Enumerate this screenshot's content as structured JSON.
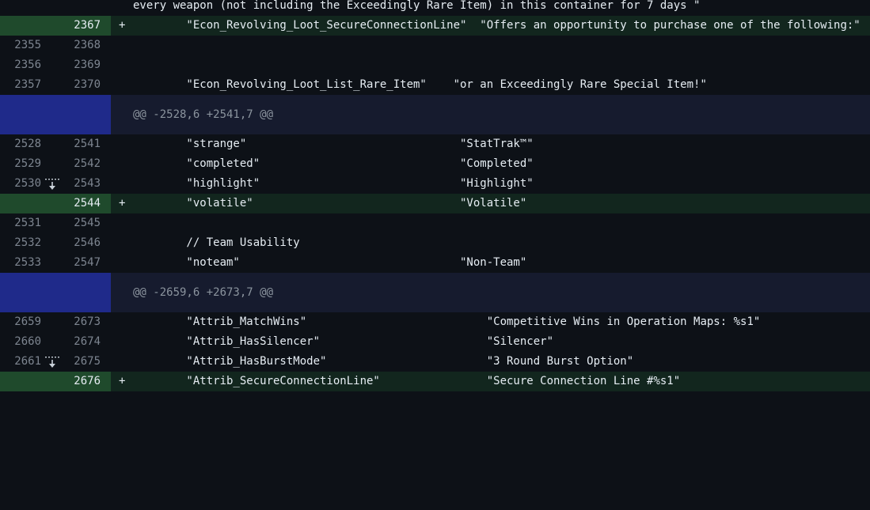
{
  "diff": {
    "rows": [
      {
        "type": "context",
        "old": "",
        "new": "",
        "marker": "",
        "code": "every weapon (not including the Exceedingly Rare Item) in this container for 7 days \""
      },
      {
        "type": "add",
        "old": "",
        "new": "2367",
        "marker": "+",
        "code": "        \"Econ_Revolving_Loot_SecureConnectionLine\"  \"Offers an opportunity to purchase one of the following:\""
      },
      {
        "type": "context",
        "old": "2355",
        "new": "2368",
        "marker": "",
        "code": ""
      },
      {
        "type": "context",
        "old": "2356",
        "new": "2369",
        "marker": "",
        "code": ""
      },
      {
        "type": "context",
        "old": "2357",
        "new": "2370",
        "marker": "",
        "code": "        \"Econ_Revolving_Loot_List_Rare_Item\"    \"or an Exceedingly Rare Special Item!\""
      },
      {
        "type": "hunk",
        "text": "@@ -2528,6 +2541,7 @@",
        "expand_down": "expand-down",
        "expand_up": "expand-up"
      },
      {
        "type": "context",
        "old": "2528",
        "new": "2541",
        "marker": "",
        "code": "        \"strange\"                                \"StatTrak™\""
      },
      {
        "type": "context",
        "old": "2529",
        "new": "2542",
        "marker": "",
        "code": "        \"completed\"                              \"Completed\""
      },
      {
        "type": "context",
        "old": "2530",
        "new": "2543",
        "marker": "",
        "code": "        \"highlight\"                              \"Highlight\""
      },
      {
        "type": "add",
        "old": "",
        "new": "2544",
        "marker": "+",
        "code": "        \"volatile\"                               \"Volatile\""
      },
      {
        "type": "context",
        "old": "2531",
        "new": "2545",
        "marker": "",
        "code": ""
      },
      {
        "type": "context",
        "old": "2532",
        "new": "2546",
        "marker": "",
        "code": "        // Team Usability"
      },
      {
        "type": "context",
        "old": "2533",
        "new": "2547",
        "marker": "",
        "code": "        \"noteam\"                                 \"Non-Team\""
      },
      {
        "type": "hunk",
        "text": "@@ -2659,6 +2673,7 @@",
        "expand_down": "expand-down",
        "expand_up": "expand-up"
      },
      {
        "type": "context",
        "old": "2659",
        "new": "2673",
        "marker": "",
        "code": "        \"Attrib_MatchWins\"                           \"Competitive Wins in Operation Maps: %s1\""
      },
      {
        "type": "context",
        "old": "2660",
        "new": "2674",
        "marker": "",
        "code": "        \"Attrib_HasSilencer\"                         \"Silencer\""
      },
      {
        "type": "context",
        "old": "2661",
        "new": "2675",
        "marker": "",
        "code": "        \"Attrib_HasBurstMode\"                        \"3 Round Burst Option\""
      },
      {
        "type": "add",
        "old": "",
        "new": "2676",
        "marker": "+",
        "code": "        \"Attrib_SecureConnectionLine\"                \"Secure Connection Line #%s1\""
      }
    ]
  },
  "colors": {
    "background": "#0d1117",
    "addition_row": "#12261e",
    "addition_gutter": "#1f4a2c",
    "hunk_row": "#161b2e",
    "expander": "#1f2a8a"
  },
  "icons": {
    "expand_down": "arrow-down-dotted-icon",
    "expand_up": "arrow-up-dotted-icon"
  }
}
